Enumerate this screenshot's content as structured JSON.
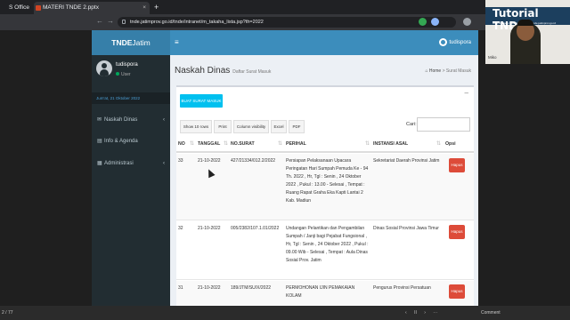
{
  "browser": {
    "tabs": [
      {
        "label": "S Office"
      },
      {
        "label": "MATERI TNDE 2.pptx",
        "close": "×"
      }
    ],
    "new_tab": "+",
    "url": "tnde.jatimprov.go.id/tnde/intranet/m_takaha_lista.jsp?th=2022"
  },
  "webcam": {
    "title": "Tutorial TNDE",
    "subtitle": "Bisa di akses melalui link : https://tnde.jatimprov.go.id",
    "label": "Miko"
  },
  "app": {
    "brand_bold": "TNDE",
    "brand_rest": "Jatim",
    "user": {
      "name": "tudispora",
      "role": "User"
    },
    "date": "Jum'at, 21 Oktober 2022",
    "menu": [
      {
        "label": "Naskah Dinas",
        "icon": "mail-icon",
        "chevron": "‹"
      },
      {
        "label": "Info & Agenda",
        "icon": "file-icon",
        "chevron": ""
      },
      {
        "label": "Administrasi",
        "icon": "grid-icon",
        "chevron": "‹"
      }
    ],
    "top_user": "tudispora",
    "page_title": "Naskah Dinas",
    "page_subtitle": "Daftar Surat Masuk",
    "breadcrumb": {
      "home": "Home",
      "sep": ">",
      "current": "Surat Masuk"
    },
    "collapse": "–",
    "create_button": "BUAT SURAT MASUK",
    "tools": [
      "Show 10 rows",
      "Print",
      "Column visibility",
      "Excel",
      "PDF"
    ],
    "search_label": "Cari:",
    "columns": [
      "NO",
      "TANGGAL",
      "NO.SURAT",
      "PERIHAL",
      "INSTANSI ASAL",
      "Opsi"
    ],
    "rows": [
      {
        "no": "33",
        "tanggal": "21-10-2022",
        "no_surat": "427/21334/012.2/2022",
        "perihal": "Persiapan Pelaksanaan Upacara Peringatan Hari Sumpah Pemuda Ke - 94 Th. 2022 , Hr, Tgl : Senin , 24 Oktober 2022 , Pukul : 13.00 - Selesai , Tempat : Ruang Rapat Graha Eka Kapti Lantai 2 Kab. Madiun",
        "instansi": "Sekretariat Daerah Provinsi Jatim",
        "opsi": "Hapus"
      },
      {
        "no": "32",
        "tanggal": "21-10-2022",
        "no_surat": "005/2382/107.1.01/2022",
        "perihal": "Undangan Pelantikan dan Pengambilan Sumpah / Janji bagi Pejabat Fungsional , Hr, Tgl : Senin , 24 Oktober 2022 , Pukul : 09.00 Wib - Selesai , Tempat : Aula Dinas Sosial Prov. Jatim",
        "instansi": "Dinas Sosial Provinsi Jawa Timur",
        "opsi": "Hapus"
      },
      {
        "no": "31",
        "tanggal": "21-10-2022",
        "no_surat": "189/JTM/SU/X/2022",
        "perihal": "PERMOHONAN IJIN PEMAKAIAN KOLAM",
        "instansi": "Pengurus Provinsi Persatuan",
        "opsi": "Hapus"
      }
    ]
  },
  "statusbar": {
    "slide": "2 / 77",
    "controls": [
      "‹",
      "II",
      "›",
      "⋯"
    ],
    "comment": "Comment"
  }
}
